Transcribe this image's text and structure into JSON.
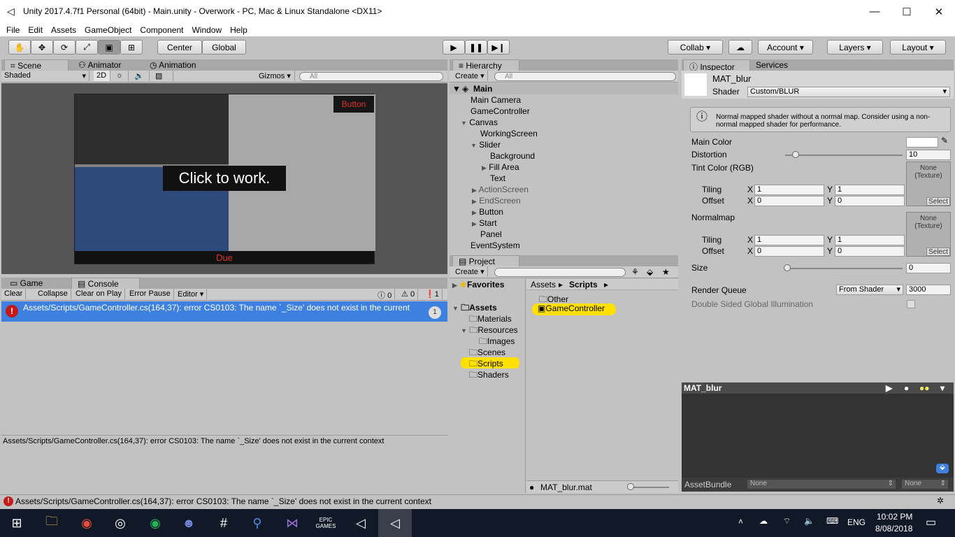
{
  "window": {
    "title": "Unity 2017.4.7f1 Personal (64bit) - Main.unity - Overwork - PC, Mac & Linux Standalone <DX11>"
  },
  "menu": [
    "File",
    "Edit",
    "Assets",
    "GameObject",
    "Component",
    "Window",
    "Help"
  ],
  "toolbar": {
    "center_label": "Center",
    "global_label": "Global",
    "collab_label": "Collab",
    "account_label": "Account",
    "layers_label": "Layers",
    "layout_label": "Layout"
  },
  "scene_panel": {
    "tabs": [
      "Scene",
      "Animator",
      "Animation"
    ],
    "shading": "Shaded",
    "mode_2d": "2D",
    "gizmos": "Gizmos",
    "search_placeholder": "All",
    "game_button_label": "Button",
    "click_to_work": "Click to work.",
    "due_label": "Due"
  },
  "console": {
    "tabs": [
      "Game",
      "Console"
    ],
    "buttons": [
      "Clear",
      "Collapse",
      "Clear on Play",
      "Error Pause",
      "Editor"
    ],
    "info_count": "0",
    "warn_count": "0",
    "error_count": "1",
    "entry_text": "Assets/Scripts/GameController.cs(164,37): error CS0103: The name `_Size' does not exist in the current",
    "entry_count": "1",
    "detail_text": "Assets/Scripts/GameController.cs(164,37): error CS0103: The name `_Size' does not exist in the current context"
  },
  "hierarchy": {
    "tab": "Hierarchy",
    "create": "Create",
    "search_placeholder": "All",
    "scene": "Main",
    "items": [
      "Main Camera",
      "GameController",
      "Canvas",
      "WorkingScreen",
      "Slider",
      "Background",
      "Fill Area",
      "Text",
      "ActionScreen",
      "EndScreen",
      "Button",
      "Start",
      "Panel",
      "EventSystem"
    ]
  },
  "project": {
    "tab": "Project",
    "create": "Create",
    "favorites": "Favorites",
    "assets": "Assets",
    "tree": [
      "Materials",
      "Resources",
      "Images",
      "Scenes",
      "Scripts",
      "Shaders"
    ],
    "breadcrumb_root": "Assets",
    "breadcrumb_current": "Scripts",
    "files": [
      "Other",
      "GameController"
    ],
    "selected_file": "MAT_blur.mat"
  },
  "inspector": {
    "tabs": [
      "Inspector",
      "Services"
    ],
    "material_name": "MAT_blur",
    "shader_label": "Shader",
    "shader_value": "Custom/BLUR",
    "warning": "Normal mapped shader without a normal map. Consider using a non-normal mapped shader for performance.",
    "main_color": "Main Color",
    "distortion": "Distortion",
    "distortion_value": "10",
    "tint": "Tint Color (RGB)",
    "tiling": "Tiling",
    "offset": "Offset",
    "normalmap": "Normalmap",
    "tex_none": "None",
    "tex_texture": "(Texture)",
    "select": "Select",
    "x": "X",
    "y": "Y",
    "tiling_x": "1",
    "tiling_y": "1",
    "offset_x": "0",
    "offset_y": "0",
    "size": "Size",
    "size_value": "0",
    "render_queue": "Render Queue",
    "render_queue_mode": "From Shader",
    "render_queue_value": "3000",
    "double_sided": "Double Sided Global Illumination",
    "preview_title": "MAT_blur",
    "assetbundle": "AssetBundle",
    "none": "None"
  },
  "statusbar": {
    "text": "Assets/Scripts/GameController.cs(164,37): error CS0103: The name `_Size' does not exist in the current context"
  },
  "taskbar": {
    "lang": "ENG",
    "time": "10:02 PM",
    "date": "8/08/2018",
    "epic": "EPIC GAMES"
  }
}
